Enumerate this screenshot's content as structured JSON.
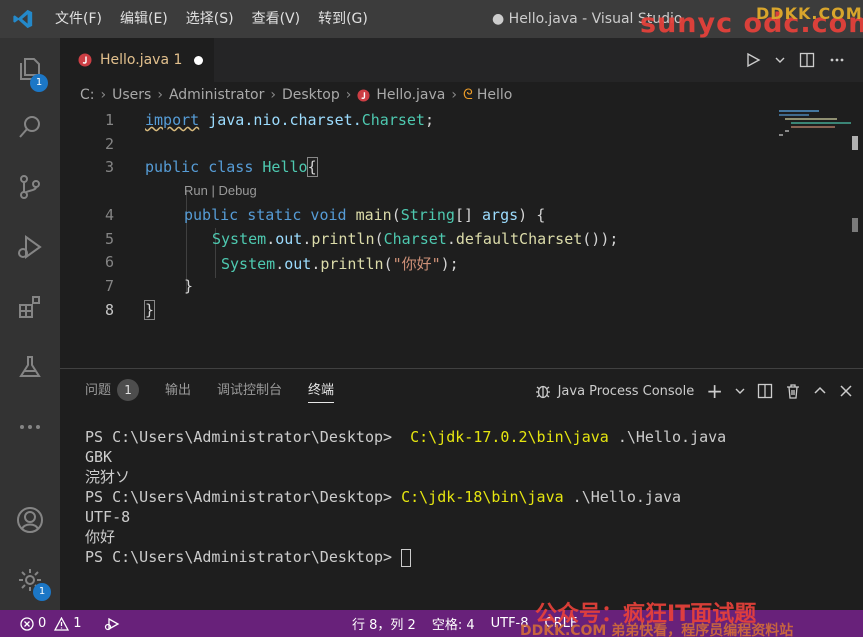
{
  "titlebar": {
    "menu": [
      "文件(F)",
      "编辑(E)",
      "选择(S)",
      "查看(V)",
      "转到(G)"
    ],
    "window_title": "● Hello.java - Visual Studio"
  },
  "watermarks": {
    "top_small": "DDKK.COM",
    "top_big": "sunyc odc.com",
    "bottom_big": "公众号：疯狂IT面试题",
    "bottom_small": "DDKK.COM 弟弟快看，程序员编程资料站"
  },
  "activity": {
    "explorer_badge": "1",
    "settings_badge": "1"
  },
  "tab": {
    "label": "Hello.java",
    "problems": "1"
  },
  "breadcrumb": [
    "C:",
    "Users",
    "Administrator",
    "Desktop",
    "Hello.java",
    "Hello"
  ],
  "editor": {
    "line_numbers": [
      "1",
      "2",
      "3",
      "4",
      "5",
      "6",
      "7",
      "8"
    ],
    "codelens": "Run | Debug",
    "lines": {
      "l1a": "import",
      "l1b": " java.nio.charset.",
      "l1c": "Charset",
      "l1d": ";",
      "l3a": "public class",
      "l3b": " Hello",
      "l3c": "{",
      "l4a": "public static void",
      "l4b": " main",
      "l4c": "(",
      "l4d": "String",
      "l4e": "[] ",
      "l4f": "args",
      "l4g": ") {",
      "l5a": "System",
      "l5b": ".",
      "l5c": "out",
      "l5d": ".",
      "l5e": "println",
      "l5f": "(",
      "l5g": "Charset",
      "l5h": ".",
      "l5i": "defaultCharset",
      "l5j": "());",
      "l6a": "System",
      "l6b": ".",
      "l6c": "out",
      "l6d": ".",
      "l6e": "println",
      "l6f": "(",
      "l6g": "\"你好\"",
      "l6h": ");",
      "l7": "}",
      "l8": "}"
    }
  },
  "panel": {
    "tabs": [
      "问题",
      "输出",
      "调试控制台",
      "终端"
    ],
    "problems_count": "1",
    "terminal_name": "Java Process Console"
  },
  "terminal": {
    "prompt": "PS C:\\Users\\Administrator\\Desktop> ",
    "cmd1": " C:\\jdk-17.0.2\\bin\\java",
    "arg1": " .\\Hello.java",
    "out1": "GBK",
    "out2": "浣犲ソ",
    "cmd2": "C:\\jdk-18\\bin\\java",
    "arg2": " .\\Hello.java",
    "out3": "UTF-8",
    "out4": "你好"
  },
  "status": {
    "errors": "0",
    "warnings": "1",
    "position": "行 8，列 2",
    "spaces": "空格: 4",
    "encoding": "UTF-8",
    "eol": "CRLF"
  },
  "colors": {
    "statusbar": "#68217a",
    "accent": "#1c77c6"
  }
}
